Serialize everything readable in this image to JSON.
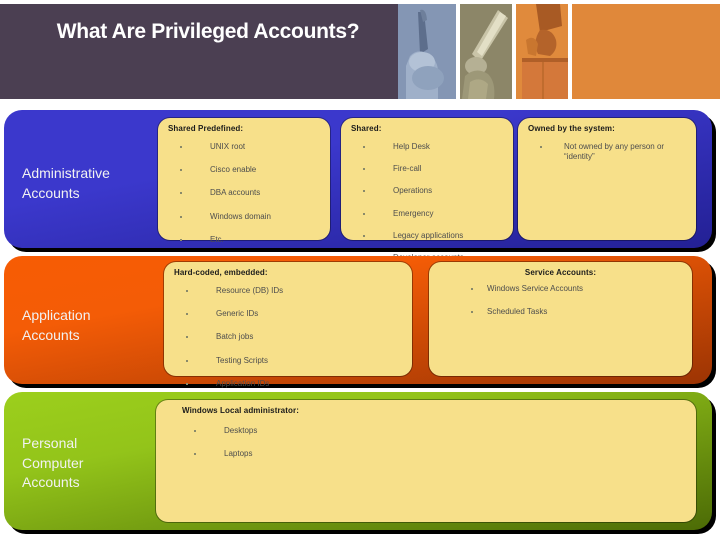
{
  "header": {
    "title": "What Are Privileged Accounts?",
    "bg_color": "#4b3f52",
    "accent_color": "#e0883a",
    "strips": [
      {
        "name": "photo-strip-blue",
        "tint": "#8496b4"
      },
      {
        "name": "photo-strip-olive",
        "tint": "#8c8668"
      },
      {
        "name": "photo-strip-orange",
        "tint": "#e08a3c"
      }
    ]
  },
  "rows": [
    {
      "id": "administrative-accounts",
      "label": "Administrative\nAccounts",
      "label_line1": "Administrative",
      "label_line2": "Accounts",
      "band_color": "#3b38cc",
      "cards": [
        {
          "id": "shared-predefined",
          "title": "Shared Predefined:",
          "items": [
            "UNIX root",
            "Cisco enable",
            "DBA accounts",
            "Windows domain",
            "Etc."
          ]
        },
        {
          "id": "shared",
          "title": "Shared:",
          "items": [
            "Help Desk",
            "Fire-call",
            "Operations",
            "Emergency",
            "Legacy applications",
            "Developer accounts"
          ]
        },
        {
          "id": "owned-by-the-system",
          "title": "Owned by the system:",
          "items": [
            "Not owned by any person or “identity”"
          ]
        }
      ]
    },
    {
      "id": "application-accounts",
      "label_line1": "Application",
      "label_line2": "Accounts",
      "band_color": "#f75c04",
      "cards": [
        {
          "id": "hard-coded-embedded",
          "title": "Hard-coded, embedded:",
          "items": [
            "Resource (DB) IDs",
            "Generic IDs",
            "Batch jobs",
            "Testing Scripts",
            "Application IDs"
          ]
        },
        {
          "id": "service-accounts",
          "title": "Service Accounts:",
          "items": [
            "Windows Service Accounts",
            "Scheduled Tasks"
          ]
        }
      ]
    },
    {
      "id": "personal-computer-accounts",
      "label_line1": "Personal",
      "label_line2": "Computer",
      "label_line3": "Accounts",
      "band_color": "#9ccf1c",
      "cards": [
        {
          "id": "windows-local-administrator",
          "title": "Windows Local administrator:",
          "items": [
            "Desktops",
            "Laptops"
          ]
        }
      ]
    }
  ]
}
